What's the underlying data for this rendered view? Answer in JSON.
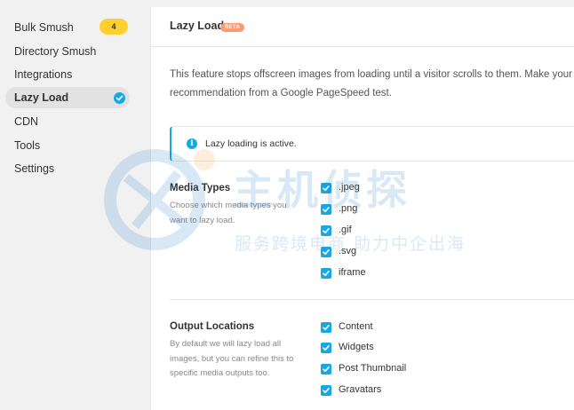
{
  "sidebar": {
    "items": [
      {
        "label": "Bulk Smush",
        "badge": "4"
      },
      {
        "label": "Directory Smush"
      },
      {
        "label": "Integrations"
      },
      {
        "label": "Lazy Load",
        "active": true
      },
      {
        "label": "CDN"
      },
      {
        "label": "Tools"
      },
      {
        "label": "Settings"
      }
    ]
  },
  "header": {
    "title": "Lazy Load",
    "tag": "BETA"
  },
  "description": {
    "line1": "This feature stops offscreen images from loading until a visitor scrolls to them. Make your page",
    "line2": "recommendation from a Google PageSpeed test."
  },
  "notice": {
    "icon": "info-icon",
    "text": "Lazy loading is active."
  },
  "media_types": {
    "title": "Media Types",
    "description": "Choose which media types you want to lazy load.",
    "options": [
      {
        "label": ".jpeg",
        "checked": true
      },
      {
        "label": ".png",
        "checked": true
      },
      {
        "label": ".gif",
        "checked": true
      },
      {
        "label": ".svg",
        "checked": true
      },
      {
        "label": "iframe",
        "checked": true
      }
    ]
  },
  "output_locations": {
    "title": "Output Locations",
    "description": "By default we will lazy load all images, but you can refine this to specific media outputs too.",
    "options": [
      {
        "label": "Content",
        "checked": true
      },
      {
        "label": "Widgets",
        "checked": true
      },
      {
        "label": "Post Thumbnail",
        "checked": true
      },
      {
        "label": "Gravatars",
        "checked": true
      }
    ]
  },
  "watermark": {
    "big": "主机侦探",
    "small": "服务跨境电商 助力中企出海"
  },
  "colors": {
    "accent": "#17a8e3",
    "badge": "#fecf2f",
    "beta": "#fd9a71"
  }
}
